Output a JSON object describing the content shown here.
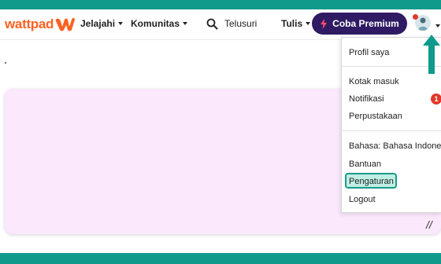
{
  "brand": {
    "logo_text": "wattpad",
    "colors": {
      "teal": "#0f9a8c",
      "orange": "#ff6122",
      "premium": "#2f1b63",
      "pink_card": "#fbe8fd",
      "badge": "#e0392b"
    }
  },
  "nav": {
    "jelajahi": "Jelajahi",
    "komunitas": "Komunitas",
    "search_label": "Telusuri",
    "tulis": "Tulis",
    "premium_label": "Coba Premium"
  },
  "icons": {
    "search": "search-icon",
    "bolt": "lightning-icon",
    "avatar": "avatar-icon",
    "caret": "chevron-down-icon",
    "arrow": "arrow-up-icon"
  },
  "menu": {
    "profil": "Profil saya",
    "kotak_masuk": "Kotak masuk",
    "notifikasi": "Notifikasi",
    "notif_count": "1",
    "perpustakaan": "Perpustakaan",
    "bahasa": "Bahasa: Bahasa Indonesia",
    "bantuan": "Bantuan",
    "pengaturan": "Pengaturan",
    "logout": "Logout"
  },
  "content": {
    "corner_mark": "//"
  }
}
